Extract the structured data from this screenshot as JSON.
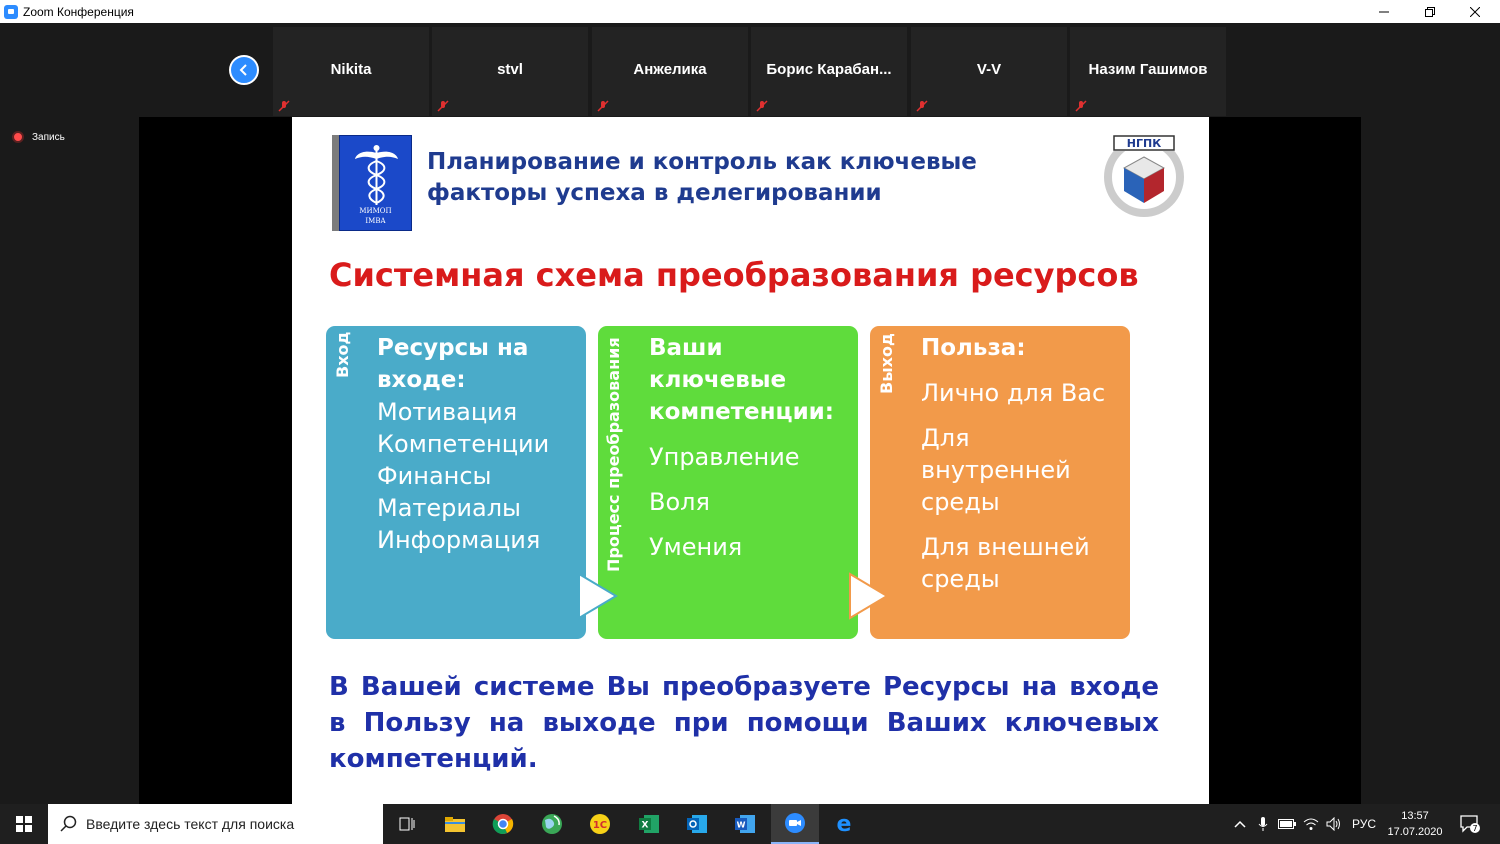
{
  "window": {
    "title": "Zoom Конференция"
  },
  "participants": [
    {
      "name": "Nikita"
    },
    {
      "name": "stvl"
    },
    {
      "name": "Анжелика"
    },
    {
      "name": "Борис  Карабан..."
    },
    {
      "name": "V-V"
    },
    {
      "name": "Назим Гашимов"
    }
  ],
  "recording": {
    "label": "Запись"
  },
  "slide": {
    "book": {
      "line1": "МИМОП",
      "line2": "IMBA"
    },
    "logo_text": "НГПК",
    "title": "Планирование и контроль как ключевые факторы успеха в делегировании",
    "heading": "Системная схема преобразования ресурсов",
    "boxes": [
      {
        "side_label": "Вход",
        "title_lines": [
          "Ресурсы на",
          "входе:"
        ],
        "items": [
          "Мотивация",
          "Компетенции",
          "Финансы",
          "Материалы",
          "Информация"
        ],
        "color": "#4aabc9"
      },
      {
        "side_label": "Процесс преобразования",
        "title_lines": [
          "Ваши",
          "ключевые",
          "компетенции:"
        ],
        "items": [
          "Управление",
          "Воля",
          "Умения"
        ],
        "color": "#5fdc3c"
      },
      {
        "side_label": "Выход",
        "title_lines": [
          "Польза:"
        ],
        "items": [
          "Лично для Вас",
          "Для внутренней среды",
          "Для внешней среды"
        ],
        "color": "#f29a4a"
      }
    ],
    "footer": "В Вашей системе Вы преобразуете Ресурсы на входе в Пользу на выходе при помощи Ваших ключевых компетенций."
  },
  "taskbar": {
    "search_placeholder": "Введите здесь текст для поиска",
    "language": "РУС",
    "time": "13:57",
    "date": "17.07.2020",
    "notification_count": "7"
  }
}
